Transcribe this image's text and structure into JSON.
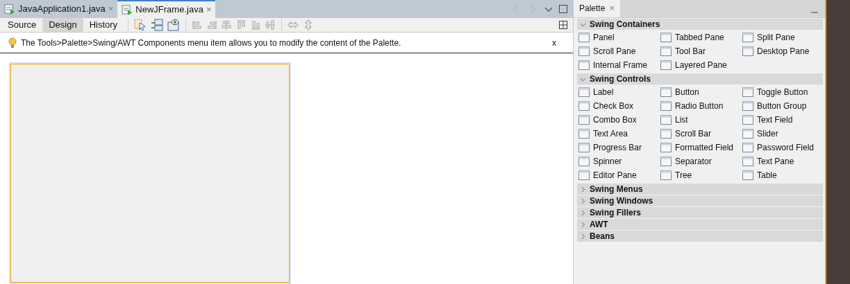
{
  "editor_tabs": [
    {
      "label": "JavaApplication1.java",
      "close": "×",
      "selected": false
    },
    {
      "label": "NewJFrame.java",
      "close": "×",
      "selected": true
    }
  ],
  "view_tabs": [
    {
      "label": "Source",
      "selected": false
    },
    {
      "label": "Design",
      "selected": true
    },
    {
      "label": "History",
      "selected": false
    }
  ],
  "hint": {
    "text": "The Tools>Palette>Swing/AWT Components menu item allows you to modify the content of the Palette.",
    "close": "x"
  },
  "palette": {
    "title": "Palette",
    "close": "×",
    "categories": [
      {
        "name": "Swing Containers",
        "expanded": true,
        "items": [
          "Panel",
          "Tabbed Pane",
          "Split Pane",
          "Scroll Pane",
          "Tool Bar",
          "Desktop Pane",
          "Internal Frame",
          "Layered Pane"
        ]
      },
      {
        "name": "Swing Controls",
        "expanded": true,
        "items": [
          "Label",
          "Button",
          "Toggle Button",
          "Check Box",
          "Radio Button",
          "Button Group",
          "Combo Box",
          "List",
          "Text Field",
          "Text Area",
          "Scroll Bar",
          "Slider",
          "Progress Bar",
          "Formatted Field",
          "Password Field",
          "Spinner",
          "Separator",
          "Text Pane",
          "Editor Pane",
          "Tree",
          "Table"
        ]
      },
      {
        "name": "Swing Menus",
        "expanded": false
      },
      {
        "name": "Swing Windows",
        "expanded": false
      },
      {
        "name": "Swing Fillers",
        "expanded": false
      },
      {
        "name": "AWT",
        "expanded": false
      },
      {
        "name": "Beans",
        "expanded": false
      }
    ]
  }
}
